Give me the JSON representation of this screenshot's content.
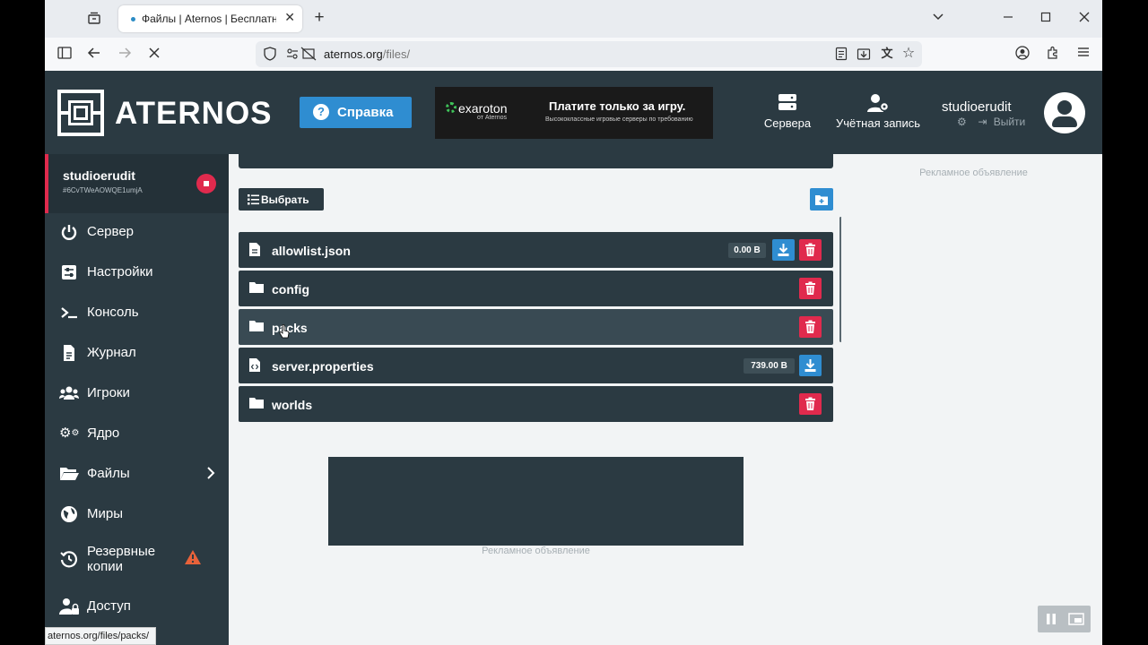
{
  "browser": {
    "tab_title": "Файлы | Aternos | Бесплатный",
    "url_domain": "aternos.org",
    "url_path": "/files/",
    "status_url": "aternos.org/files/packs/"
  },
  "header": {
    "logo_text": "ATERNOS",
    "help_label": "Справка",
    "banner": {
      "brand": "exaroton",
      "brand_sub": "от Aternos",
      "headline": "Платите только за игру.",
      "subline": "Высококлассные игровые серверы по требованию"
    },
    "nav_servers": "Сервера",
    "nav_account": "Учётная запись",
    "username": "studioerudit",
    "logout": "Выйти"
  },
  "sidebar": {
    "server_name": "studioerudit",
    "server_id": "#6CvTWeAOWQE1umjA",
    "items": [
      {
        "label": "Сервер",
        "icon": "power-icon"
      },
      {
        "label": "Настройки",
        "icon": "sliders-icon"
      },
      {
        "label": "Консоль",
        "icon": "terminal-icon"
      },
      {
        "label": "Журнал",
        "icon": "file-text-icon"
      },
      {
        "label": "Игроки",
        "icon": "users-icon"
      },
      {
        "label": "Ядро",
        "icon": "cogs-icon"
      },
      {
        "label": "Файлы",
        "icon": "folder-icon"
      },
      {
        "label": "Миры",
        "icon": "globe-icon"
      },
      {
        "label": "Резервные копии",
        "icon": "history-icon"
      },
      {
        "label": "Доступ",
        "icon": "user-lock-icon"
      }
    ]
  },
  "files": {
    "select_label": "Выбрать",
    "rows": [
      {
        "name": "allowlist.json",
        "type": "file",
        "size": "0.00 B",
        "download": true,
        "delete": true
      },
      {
        "name": "config",
        "type": "folder",
        "size": "",
        "download": false,
        "delete": true
      },
      {
        "name": "packs",
        "type": "folder",
        "size": "",
        "download": false,
        "delete": true
      },
      {
        "name": "server.properties",
        "type": "file",
        "size": "739.00 B",
        "download": true,
        "delete": false
      },
      {
        "name": "worlds",
        "type": "folder",
        "size": "",
        "download": false,
        "delete": true
      }
    ]
  },
  "ads": {
    "label": "Рекламное объявление"
  },
  "colors": {
    "primary_dark": "#2b3a42",
    "accent_blue": "#2f8dd1",
    "danger_red": "#e02a4d",
    "warning_orange": "#e8623a"
  }
}
